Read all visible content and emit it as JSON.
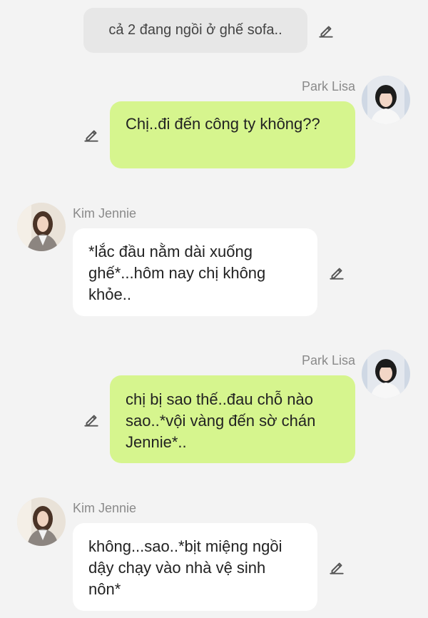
{
  "narration": {
    "text": "cả 2 đang ngồi ở ghế sofa.."
  },
  "messages": [
    {
      "sender": "Park Lisa",
      "text": "Chị..đi đến công ty không??"
    },
    {
      "sender": "Kim Jennie",
      "text": "*lắc đầu nằm dài xuống ghế*...hôm nay chị không khỏe.."
    },
    {
      "sender": "Park Lisa",
      "text": "chị bị sao thế..đau chỗ nào sao..*vội vàng đến sờ chán Jennie*.."
    },
    {
      "sender": "Kim Jennie",
      "text": "không...sao..*bịt miệng ngồi dậy chạy vào nhà vệ sinh nôn*"
    }
  ],
  "icons": {
    "edit": "pencil-icon"
  },
  "colors": {
    "background": "#f3f3f3",
    "outgoing_bubble": "#d6f58e",
    "incoming_bubble": "#ffffff",
    "narration_bubble": "#e7e7e7"
  }
}
